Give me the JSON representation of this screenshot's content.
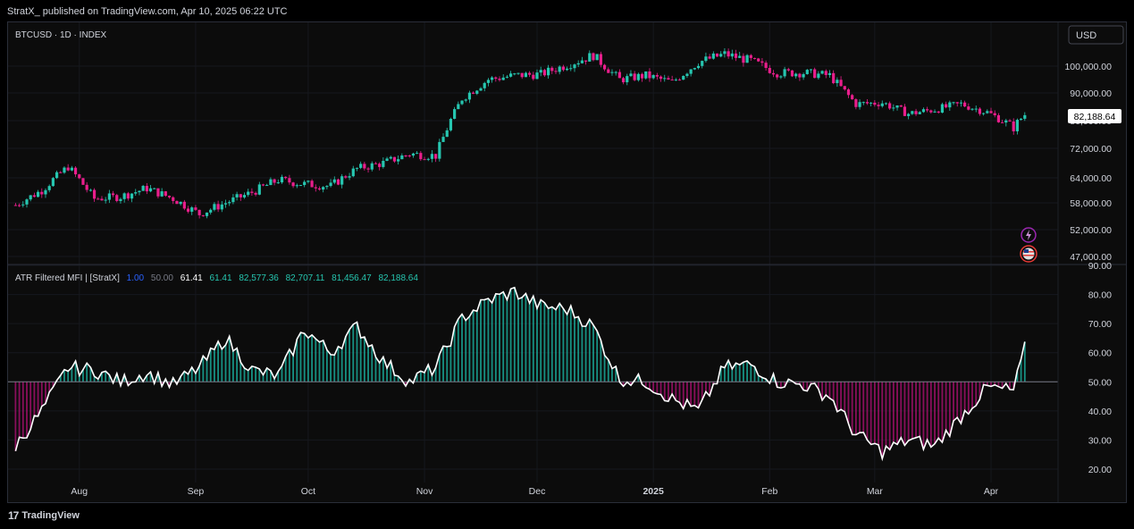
{
  "header": {
    "published": "StratX_ published on TradingView.com, Apr 10, 2025 06:22 UTC"
  },
  "price_pane": {
    "symbol": "BTCUSD · 1D · INDEX",
    "currency": "USD",
    "last_price_label": "82,188.64",
    "y_ticks": [
      "100,000.00",
      "90,000.00",
      "80,000.00",
      "72,000.00",
      "64,000.00",
      "58,000.00",
      "52,000.00",
      "47,000.00"
    ]
  },
  "indicator_pane": {
    "name": "ATR Filtered MFI | [StratX]",
    "params": [
      "1.00",
      "50.00"
    ],
    "values": [
      "61.41",
      "61.41",
      "82,577.36",
      "82,707.11",
      "81,456.47",
      "82,188.64"
    ],
    "y_ticks": [
      "90.00",
      "80.00",
      "70.00",
      "60.00",
      "50.00",
      "40.00",
      "30.00",
      "20.00"
    ]
  },
  "x_ticks": [
    "Aug",
    "Sep",
    "Oct",
    "Nov",
    "Dec",
    "2025",
    "Feb",
    "Mar",
    "Apr"
  ],
  "footer": {
    "brand": "TradingView",
    "logo_glyph": "17"
  },
  "colors": {
    "up": "#26c6b0",
    "down": "#e91e8c",
    "mfi_line": "#ffffff",
    "mfi_up_fill": "#1aa898",
    "mfi_down_fill": "#a0106a",
    "param_blue": "#2962ff",
    "value_teal": "#26c6b0"
  },
  "chart_data": [
    {
      "type": "line",
      "name": "BTCUSD",
      "x": [
        "2024-07-15",
        "2024-07-22",
        "2024-07-29",
        "2024-08-05",
        "2024-08-12",
        "2024-08-19",
        "2024-08-26",
        "2024-09-02",
        "2024-09-09",
        "2024-09-16",
        "2024-09-23",
        "2024-09-30",
        "2024-10-07",
        "2024-10-14",
        "2024-10-21",
        "2024-10-28",
        "2024-11-04",
        "2024-11-11",
        "2024-11-18",
        "2024-11-25",
        "2024-12-02",
        "2024-12-09",
        "2024-12-16",
        "2024-12-23",
        "2024-12-30",
        "2025-01-06",
        "2025-01-13",
        "2025-01-20",
        "2025-01-27",
        "2025-02-03",
        "2025-02-10",
        "2025-02-17",
        "2025-02-24",
        "2025-03-03",
        "2025-03-10",
        "2025-03-17",
        "2025-03-24",
        "2025-03-31",
        "2025-04-07",
        "2025-04-10"
      ],
      "values": [
        57500,
        61000,
        67000,
        59000,
        59500,
        61500,
        59000,
        55500,
        58000,
        60500,
        63500,
        62500,
        62000,
        66500,
        68000,
        70500,
        70000,
        88000,
        95000,
        96500,
        97000,
        100500,
        104000,
        95000,
        96500,
        94000,
        101500,
        104500,
        102000,
        97500,
        97500,
        96500,
        86000,
        86500,
        82500,
        84000,
        86000,
        83000,
        78000,
        82188.64
      ],
      "ylim": [
        47000,
        106000
      ]
    },
    {
      "type": "area",
      "name": "ATR Filtered MFI",
      "x": [
        "2024-07-15",
        "2024-07-22",
        "2024-07-29",
        "2024-08-05",
        "2024-08-12",
        "2024-08-19",
        "2024-08-26",
        "2024-09-02",
        "2024-09-09",
        "2024-09-16",
        "2024-09-23",
        "2024-09-30",
        "2024-10-07",
        "2024-10-14",
        "2024-10-21",
        "2024-10-28",
        "2024-11-04",
        "2024-11-11",
        "2024-11-18",
        "2024-11-25",
        "2024-12-02",
        "2024-12-09",
        "2024-12-16",
        "2024-12-23",
        "2024-12-30",
        "2025-01-06",
        "2025-01-13",
        "2025-01-20",
        "2025-01-27",
        "2025-02-03",
        "2025-02-10",
        "2025-02-17",
        "2025-02-24",
        "2025-03-03",
        "2025-03-10",
        "2025-03-17",
        "2025-03-24",
        "2025-03-31",
        "2025-04-07",
        "2025-04-10"
      ],
      "values": [
        28,
        40,
        55,
        54,
        50,
        53,
        49,
        55,
        65,
        54,
        52,
        68,
        60,
        69,
        57,
        50,
        55,
        72,
        78,
        81,
        76,
        75,
        69,
        51,
        50,
        44,
        40,
        55,
        56,
        50,
        49,
        45,
        32,
        26,
        30,
        28,
        38,
        48,
        47,
        61.41
      ],
      "baseline": 50,
      "ylim": [
        18,
        90
      ]
    }
  ]
}
